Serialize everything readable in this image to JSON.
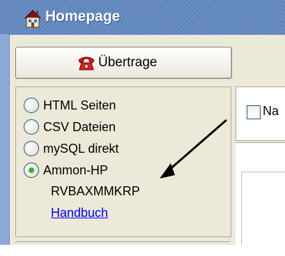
{
  "window": {
    "title": "Homepage",
    "title_icon": "house-icon"
  },
  "toolbar": {
    "send_label": "Übertrage",
    "send_icon": "telephone-icon"
  },
  "export": {
    "options": [
      {
        "label": "HTML Seiten",
        "checked": false
      },
      {
        "label": "CSV Dateien",
        "checked": false
      },
      {
        "label": "mySQL direkt",
        "checked": false
      },
      {
        "label": "Ammon-HP",
        "checked": true
      }
    ],
    "code": "RVBAXMMKRP",
    "manual_link": "Handbuch"
  },
  "right_panel": {
    "checkbox_label": "Na",
    "checked": false
  },
  "colors": {
    "titlebar": "#6f93c6",
    "link": "#0000ff",
    "radio_dot": "#31b42f"
  }
}
